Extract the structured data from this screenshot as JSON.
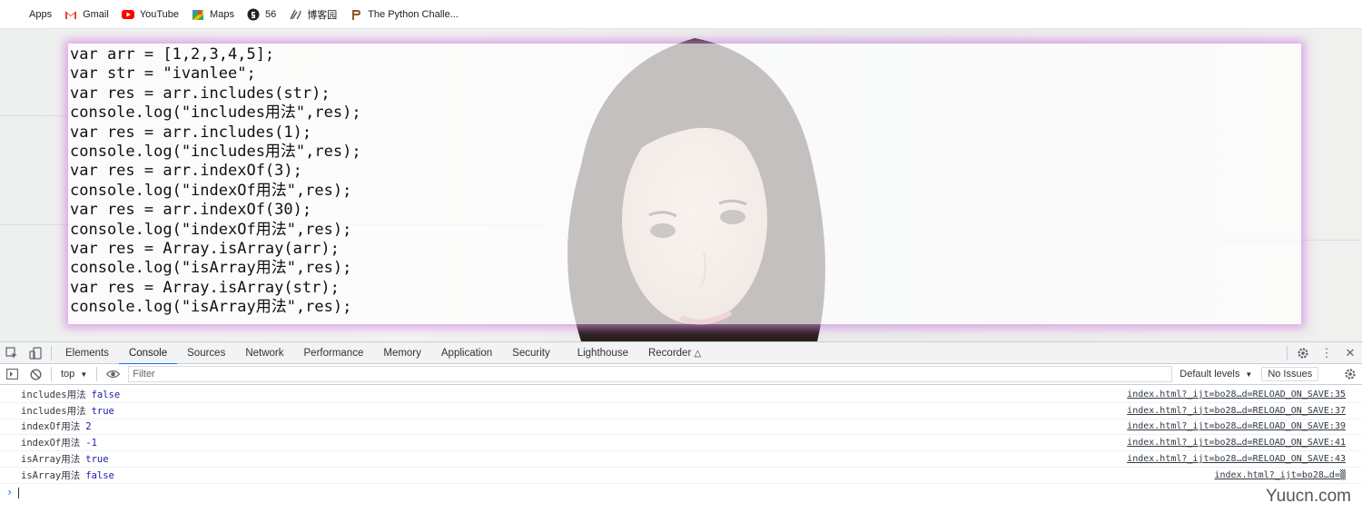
{
  "bookmarks": [
    {
      "label": "Apps",
      "icon": "apps-grid-icon"
    },
    {
      "label": "Gmail",
      "icon": "gmail-icon"
    },
    {
      "label": "YouTube",
      "icon": "youtube-icon"
    },
    {
      "label": "Maps",
      "icon": "maps-icon"
    },
    {
      "label": "56",
      "icon": "site-56-icon"
    },
    {
      "label": "博客园",
      "icon": "cnblogs-icon"
    },
    {
      "label": "The Python Challe...",
      "icon": "python-challenge-icon"
    }
  ],
  "code_lines": [
    "var arr = [1,2,3,4,5];",
    "var str = \"ivanlee\";",
    "var res = arr.includes(str);",
    "console.log(\"includes用法\",res);",
    "var res = arr.includes(1);",
    "console.log(\"includes用法\",res);",
    "var res = arr.indexOf(3);",
    "console.log(\"indexOf用法\",res);",
    "var res = arr.indexOf(30);",
    "console.log(\"indexOf用法\",res);",
    "var res = Array.isArray(arr);",
    "console.log(\"isArray用法\",res);",
    "var res = Array.isArray(str);",
    "console.log(\"isArray用法\",res);"
  ],
  "devtools": {
    "tabs": [
      "Elements",
      "Console",
      "Sources",
      "Network",
      "Performance",
      "Memory",
      "Application",
      "Security",
      "Lighthouse",
      "Recorder"
    ],
    "active_tab": "Console",
    "context": "top",
    "filter_placeholder": "Filter",
    "levels": "Default levels",
    "issues": "No Issues"
  },
  "console_rows": [
    {
      "label": "includes用法",
      "value": "false",
      "source": "index.html?_ijt=bo28…d=RELOAD_ON_SAVE:35"
    },
    {
      "label": "includes用法",
      "value": "true",
      "source": "index.html?_ijt=bo28…d=RELOAD_ON_SAVE:37"
    },
    {
      "label": "indexOf用法",
      "value": "2",
      "source": "index.html?_ijt=bo28…d=RELOAD_ON_SAVE:39"
    },
    {
      "label": "indexOf用法",
      "value": "-1",
      "source": "index.html?_ijt=bo28…d=RELOAD_ON_SAVE:41"
    },
    {
      "label": "isArray用法",
      "value": "true",
      "source": "index.html?_ijt=bo28…d=RELOAD_ON_SAVE:43"
    },
    {
      "label": "isArray用法",
      "value": "false",
      "source": "index.html?_ijt=bo28…d=▒"
    }
  ],
  "watermark": "Yuucn.com",
  "colors": {
    "accent": "#1a73e8",
    "code_shadow": "#d28cdc",
    "console_value": "#1a1aa6"
  }
}
